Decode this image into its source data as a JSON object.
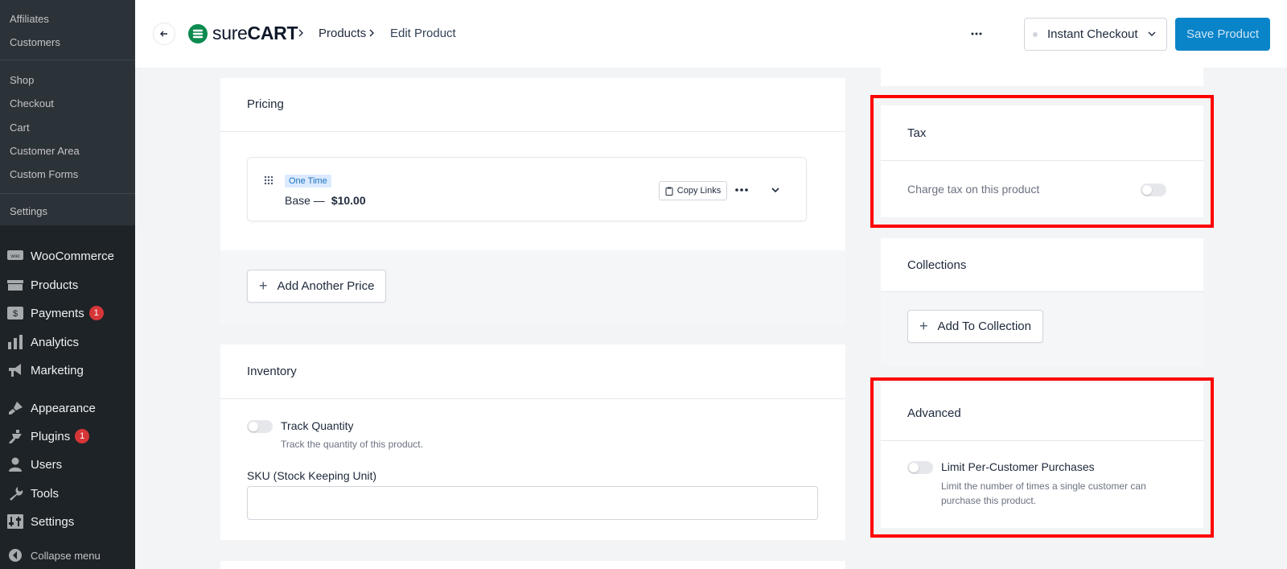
{
  "sidebar": {
    "submenu_top": [
      "Affiliates",
      "Customers"
    ],
    "submenu_bottom": [
      "Shop",
      "Checkout",
      "Cart",
      "Customer Area",
      "Custom Forms"
    ],
    "settings_sub": "Settings",
    "menu": [
      {
        "label": "WooCommerce",
        "icon": "woocommerce-icon"
      },
      {
        "label": "Products",
        "icon": "products-icon"
      },
      {
        "label": "Payments",
        "icon": "payments-icon",
        "badge": "1"
      },
      {
        "label": "Analytics",
        "icon": "analytics-icon"
      },
      {
        "label": "Marketing",
        "icon": "megaphone-icon"
      },
      {
        "label": "Appearance",
        "icon": "paintbrush-icon"
      },
      {
        "label": "Plugins",
        "icon": "plugin-icon",
        "badge": "1"
      },
      {
        "label": "Users",
        "icon": "user-icon"
      },
      {
        "label": "Tools",
        "icon": "wrench-icon"
      },
      {
        "label": "Settings",
        "icon": "settings-icon"
      }
    ],
    "collapse": "Collapse menu"
  },
  "header": {
    "logo_light": "sure",
    "logo_bold": "CART",
    "breadcrumbs": [
      "Products",
      "Edit Product"
    ],
    "checkout_select": "Instant Checkout",
    "save_label": "Save Product"
  },
  "pricing": {
    "title": "Pricing",
    "price": {
      "tag": "One Time",
      "name": "Base —",
      "amount": "$10.00",
      "copy_links": "Copy Links"
    },
    "add_price": "Add Another Price"
  },
  "inventory": {
    "title": "Inventory",
    "track_label": "Track Quantity",
    "track_help": "Track the quantity of this product.",
    "sku_label": "SKU (Stock Keeping Unit)",
    "sku_value": ""
  },
  "tax": {
    "title": "Tax",
    "charge_label": "Charge tax on this product"
  },
  "collections": {
    "title": "Collections",
    "add_label": "Add To Collection"
  },
  "advanced": {
    "title": "Advanced",
    "limit_label": "Limit Per-Customer Purchases",
    "limit_help_1": "Limit the number of times a single customer can",
    "limit_help_2": "purchase this product."
  },
  "colors": {
    "sidebar_bg": "#1d2327",
    "primary": "#0a84c9",
    "highlight": "#ff0000",
    "brand_green": "#0c8a4f"
  }
}
